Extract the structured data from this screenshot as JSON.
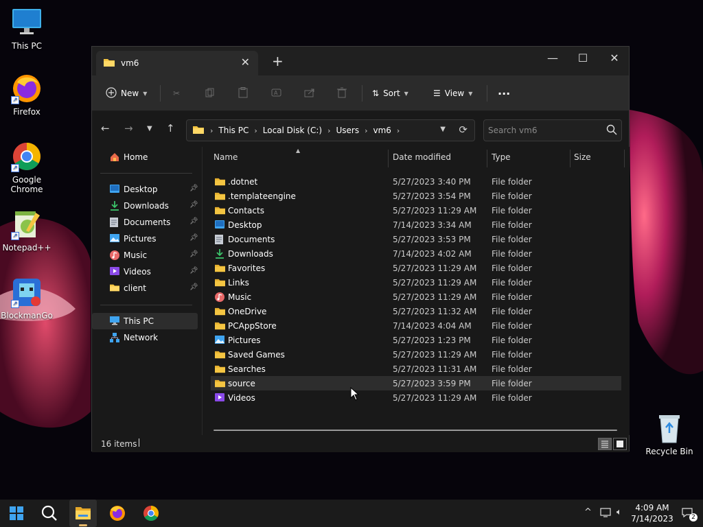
{
  "desktop": {
    "icons": [
      {
        "label": "This PC",
        "icon": "monitor-icon"
      },
      {
        "label": "Firefox",
        "icon": "firefox-icon"
      },
      {
        "label": "Google Chrome",
        "icon": "chrome-icon"
      },
      {
        "label": "Notepad++",
        "icon": "notepadpp-icon"
      },
      {
        "label": "BlockmanGo",
        "icon": "blockmango-icon"
      },
      {
        "label": "Recycle Bin",
        "icon": "recycle-bin-icon"
      }
    ]
  },
  "window": {
    "tab_title": "vm6",
    "new_tab": "+",
    "controls": {
      "minimize": "—",
      "maximize": "☐",
      "close": "✕"
    }
  },
  "toolbar": {
    "new_label": "New",
    "sort_label": "Sort",
    "view_label": "View",
    "more_label": "···",
    "actions": [
      "cut",
      "copy",
      "paste",
      "rename",
      "share",
      "delete"
    ]
  },
  "address": {
    "crumbs": [
      "This PC",
      "Local Disk (C:)",
      "Users",
      "vm6"
    ],
    "separator": "›"
  },
  "search": {
    "placeholder": "Search vm6"
  },
  "navpane": {
    "home": "Home",
    "quick_access": [
      {
        "label": "Desktop",
        "icon": "desktop-folder-icon"
      },
      {
        "label": "Downloads",
        "icon": "downloads-icon"
      },
      {
        "label": "Documents",
        "icon": "documents-icon"
      },
      {
        "label": "Pictures",
        "icon": "pictures-icon"
      },
      {
        "label": "Music",
        "icon": "music-icon"
      },
      {
        "label": "Videos",
        "icon": "videos-icon"
      },
      {
        "label": "client",
        "icon": "folder-icon"
      }
    ],
    "this_pc": "This PC",
    "network": "Network"
  },
  "columns": {
    "name": "Name",
    "date": "Date modified",
    "type": "Type",
    "size": "Size"
  },
  "files": [
    {
      "name": ".dotnet",
      "date": "5/27/2023 3:40 PM",
      "type": "File folder",
      "icon": "folder"
    },
    {
      "name": ".templateengine",
      "date": "5/27/2023 3:54 PM",
      "type": "File folder",
      "icon": "folder"
    },
    {
      "name": "Contacts",
      "date": "5/27/2023 11:29 AM",
      "type": "File folder",
      "icon": "folder"
    },
    {
      "name": "Desktop",
      "date": "7/14/2023 3:34 AM",
      "type": "File folder",
      "icon": "desktop"
    },
    {
      "name": "Documents",
      "date": "5/27/2023 3:53 PM",
      "type": "File folder",
      "icon": "documents"
    },
    {
      "name": "Downloads",
      "date": "7/14/2023 4:02 AM",
      "type": "File folder",
      "icon": "downloads"
    },
    {
      "name": "Favorites",
      "date": "5/27/2023 11:29 AM",
      "type": "File folder",
      "icon": "folder"
    },
    {
      "name": "Links",
      "date": "5/27/2023 11:29 AM",
      "type": "File folder",
      "icon": "folder"
    },
    {
      "name": "Music",
      "date": "5/27/2023 11:29 AM",
      "type": "File folder",
      "icon": "music"
    },
    {
      "name": "OneDrive",
      "date": "5/27/2023 11:32 AM",
      "type": "File folder",
      "icon": "folder"
    },
    {
      "name": "PCAppStore",
      "date": "7/14/2023 4:04 AM",
      "type": "File folder",
      "icon": "folder"
    },
    {
      "name": "Pictures",
      "date": "5/27/2023 1:23 PM",
      "type": "File folder",
      "icon": "pictures"
    },
    {
      "name": "Saved Games",
      "date": "5/27/2023 11:29 AM",
      "type": "File folder",
      "icon": "folder"
    },
    {
      "name": "Searches",
      "date": "5/27/2023 11:31 AM",
      "type": "File folder",
      "icon": "folder"
    },
    {
      "name": "source",
      "date": "5/27/2023 3:59 PM",
      "type": "File folder",
      "icon": "folder",
      "highlight": true
    },
    {
      "name": "Videos",
      "date": "5/27/2023 11:29 AM",
      "type": "File folder",
      "icon": "videos"
    }
  ],
  "status": {
    "count": "16 items"
  },
  "taskbar": {
    "time": "4:09 AM",
    "date": "7/14/2023",
    "notifications": "2"
  },
  "colors": {
    "folder": "#f4c542",
    "accent": "#4a9be8",
    "window_bg": "#191919",
    "toolbar_bg": "#2b2b2b"
  }
}
